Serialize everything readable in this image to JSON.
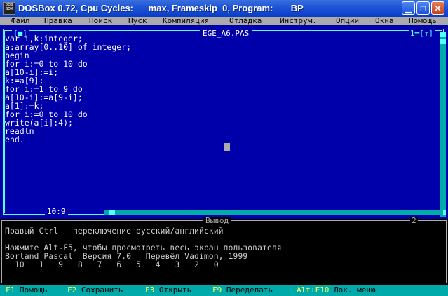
{
  "window": {
    "title": "DOSBox 0.72, Cpu Cycles:      max, Frameskip  0, Program:       BP",
    "icon_label": "DOS BOX",
    "icons": {
      "minimize": "minimize-icon",
      "maximize": "maximize-icon",
      "close": "close-icon"
    }
  },
  "menu": {
    "items": [
      "Файл",
      "Правка",
      "Поиск",
      "Пуск",
      "Компиляция",
      "Отладка",
      "Инструм.",
      "Опции",
      "Окна",
      "Помощь"
    ]
  },
  "editor": {
    "filename": "EGE_A6.PAS",
    "window_number": "1",
    "close_box": "[■]",
    "zoom_box": "1═[↑]",
    "position": "10:9",
    "code": [
      "var i,k:integer;",
      "a:array[0..10] of integer;",
      "begin",
      "for i:=0 to 10 do",
      "a[10-i]:=i;",
      "k:=a[9];",
      "for i:=1 to 9 do",
      "a[10-i]:=a[9-i];",
      "a[1]:=k;",
      "for i:=0 to 10 do",
      "write(a[i]:4);",
      "readln",
      "end."
    ]
  },
  "output": {
    "title": "Вывод",
    "window_number": "2",
    "lines": [
      "Правый Ctrl — переключение русский/английский",
      "",
      "Нажмите Alt-F5, чтобы просмотреть весь экран пользователя",
      "Borland Pascal  Версия 7.0   Перевёл Vadimon, 1999",
      "  10   1   9   8   7   6   5   4   3   2   0"
    ]
  },
  "statusbar": {
    "items": [
      {
        "key": "F1",
        "label": "Помощь"
      },
      {
        "key": "F2",
        "label": "Сохранить"
      },
      {
        "key": "F3",
        "label": "Открыть"
      },
      {
        "key": "F9",
        "label": "Переделать"
      },
      {
        "key": "Alt+F10",
        "label": "Лок. меню"
      }
    ]
  },
  "colors": {
    "editor_bg": "#0000aa",
    "menu_bg": "#aaaaaa",
    "status_bg": "#00aaaa",
    "frame": "#55ffff"
  }
}
